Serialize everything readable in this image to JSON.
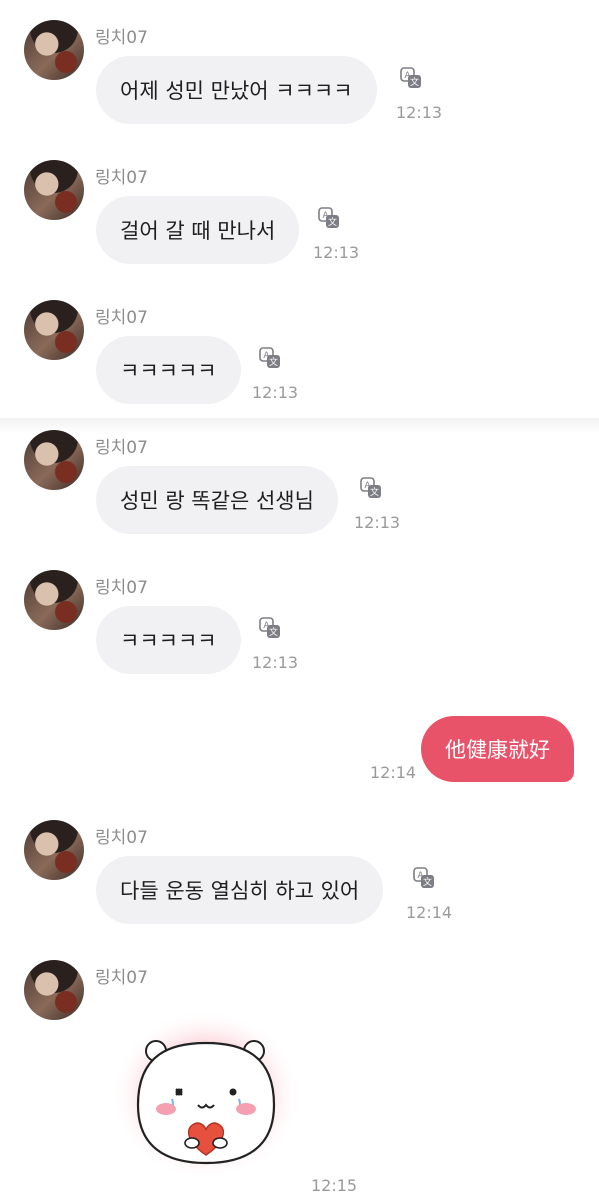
{
  "messages": [
    {
      "sender": "링치07",
      "text": "어제 성민 만났어 ㅋㅋㅋㅋ",
      "time": "12:13"
    },
    {
      "sender": "링치07",
      "text": "걸어 갈 때 만나서",
      "time": "12:13"
    },
    {
      "sender": "링치07",
      "text": "ㅋㅋㅋㅋㅋ",
      "time": "12:13"
    },
    {
      "sender": "링치07",
      "text": "성민 랑 똑같은 선생님",
      "time": "12:13"
    },
    {
      "sender": "링치07",
      "text": "ㅋㅋㅋㅋㅋ",
      "time": "12:13"
    },
    {
      "sender": "me",
      "text": "他健康就好",
      "time": "12:14"
    },
    {
      "sender": "링치07",
      "text": "다들 운동 열심히 하고 있어",
      "time": "12:14"
    },
    {
      "sender": "링치07",
      "sticker": "white-hamster-heart-sticker",
      "time": "12:15"
    }
  ],
  "colors": {
    "bubble_received": "#f1f1f3",
    "bubble_sent": "#e9536a",
    "name_text": "#8c8c8c",
    "time_text": "#9a9a9a"
  },
  "icons": {
    "translate": "translate-icon"
  }
}
